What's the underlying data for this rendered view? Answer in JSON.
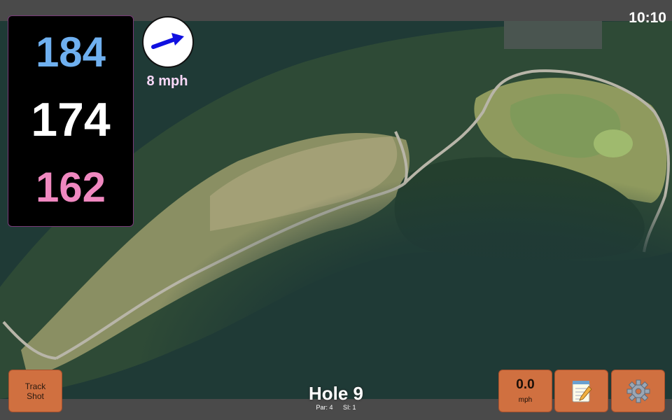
{
  "status": {
    "time": "10:10"
  },
  "yardages": {
    "back": "184",
    "center": "174",
    "front": "162"
  },
  "wind": {
    "speed_text": "8 mph",
    "icon": "wind-arrow-icon",
    "color": "#1010e0"
  },
  "hole": {
    "title": "Hole 9",
    "par": "Par: 4",
    "stroke_index": "SI: 1"
  },
  "buttons": {
    "track_shot": {
      "line1": "Track",
      "line2": "Shot"
    },
    "speed": {
      "value": "0.0",
      "unit": "mph"
    },
    "notes": {
      "icon": "notepad-icon"
    },
    "settings": {
      "icon": "gear-icon"
    }
  },
  "colors": {
    "back_yardage": "#6fb0f0",
    "center_yardage": "#ffffff",
    "front_yardage": "#f088c0",
    "button": "#d07040"
  }
}
